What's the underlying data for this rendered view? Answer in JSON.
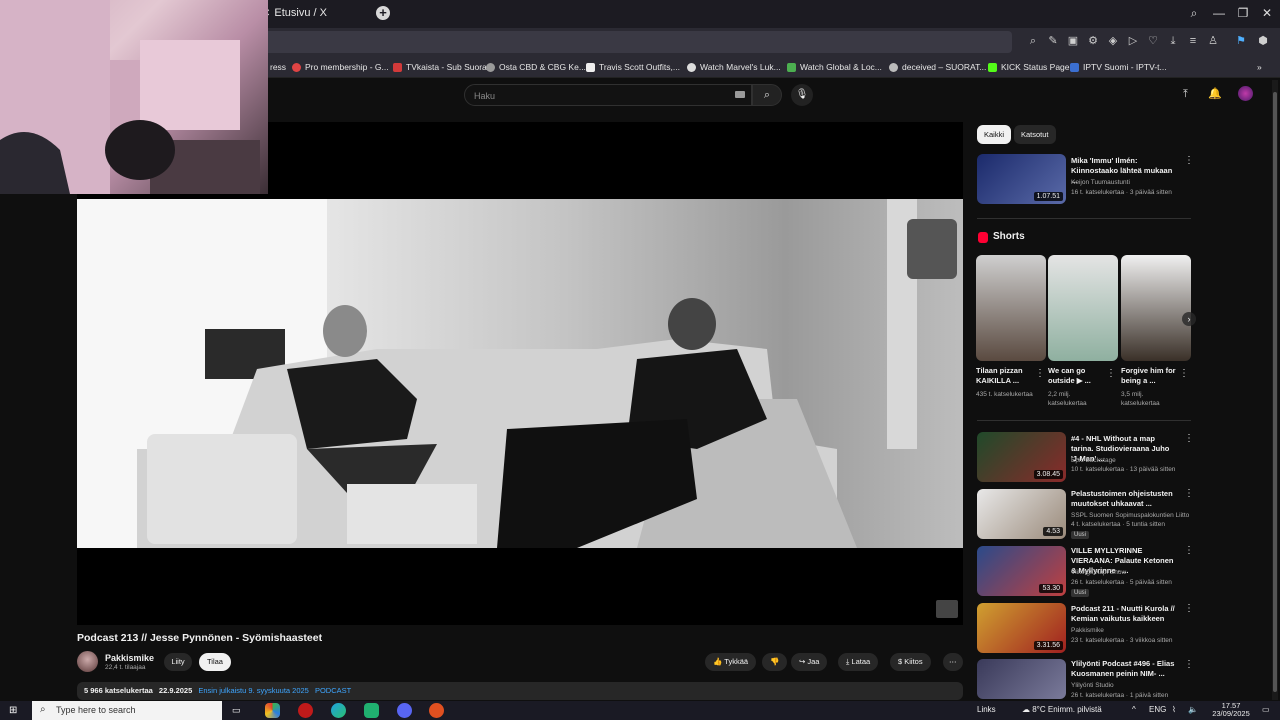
{
  "browser": {
    "active_tab": "Etusivu / X",
    "bookmarks": [
      {
        "label": "ress",
        "color": "#888888"
      },
      {
        "label": "Pro membership - G...",
        "color": "#e04444"
      },
      {
        "label": "TVkaista - Sub Suora",
        "color": "#d23a3a"
      },
      {
        "label": "Osta CBD & CBG Ke...",
        "color": "#9a9a9a"
      },
      {
        "label": "Travis Scott Outfits,...",
        "color": "#eeeeee"
      },
      {
        "label": "Watch Marvel's Luk...",
        "color": "#dddddd"
      },
      {
        "label": "Watch Global & Loc...",
        "color": "#4caf50"
      },
      {
        "label": "deceived – SUORAT...",
        "color": "#bbbbbb"
      },
      {
        "label": "KICK Status Page",
        "color": "#53fc18"
      },
      {
        "label": "IPTV Suomi - IPTV-t...",
        "color": "#3b6fd1"
      }
    ]
  },
  "youtube": {
    "search_placeholder": "Haku",
    "video": {
      "title": "Podcast 213 // Jesse Pynnönen - Syömishaasteet",
      "channel": "Pakkismike",
      "subscribers": "22,4 t. tilaajaa",
      "join_label": "Liity",
      "subscribe_label": "Tilaa",
      "like_label": "Tykkää",
      "share_label": "Jaa",
      "download_label": "Lataa",
      "thanks_label": "Kiitos",
      "views": "5 966 katselukertaa",
      "date": "22.9.2025",
      "premiere": "Ensin julkaistu 9. syyskuuta 2025",
      "tag": "PODCAST"
    },
    "chips": [
      "Kaikki",
      "Katsotut"
    ],
    "top_item": {
      "title": "Mika 'Immu' Ilmén: Kiinnostaako lähteä mukaan ...",
      "channel": "Keijon Tuumaustunti",
      "meta": "16 t. katselukertaa · 3 päivää sitten",
      "duration": "1.07.51"
    },
    "shorts_heading": "Shorts",
    "shorts": [
      {
        "title": "Tilaan pizzan KAIKILLA ...",
        "views": "435 t. katselukertaa"
      },
      {
        "title": "We can go outside ▶ ...",
        "views": "2,2 milj. katselukertaa"
      },
      {
        "title": "Forgive him for being a ...",
        "views": "3,5 milj. katselukertaa"
      }
    ],
    "related": [
      {
        "title": "#4 - NHL Without a map tarina. Studiovieraana Juho 'J-Man' ...",
        "channel": "Epic Backstage",
        "meta": "10 t. katselukertaa · 13 päivää sitten",
        "duration": "3.08.45",
        "badge": ""
      },
      {
        "title": "Pelastustoimen ohjeistusten muutokset uhkaavat ...",
        "channel": "SSPL Suomen Sopimuspalokuntien Liitto",
        "meta": "4 t. katselukertaa · 5 tuntia sitten",
        "duration": "4.53",
        "badge": "Uusi"
      },
      {
        "title": "VILLE MYLLYRINNE VIERAANA: Palaute Ketonen & Myllyrinne - ...",
        "channel": "Viikings Käpi Show",
        "meta": "26 t. katselukertaa · 5 päivää sitten",
        "duration": "53.30",
        "badge": "Uusi"
      },
      {
        "title": "Podcast 211 - Nuutti Kurola // Kemian vaikutus kaikkeen",
        "channel": "Pakkismike",
        "meta": "23 t. katselukertaa · 3 viikkoa sitten",
        "duration": "3.31.56",
        "badge": ""
      },
      {
        "title": "Ylilyönti Podcast #496 - Elias Kuosmanen peinin NIM- ...",
        "channel": "Ylilyönti Studio",
        "meta": "26 t. katselukertaa · 1 päivä sitten",
        "duration": "",
        "badge": ""
      }
    ]
  },
  "taskbar": {
    "search_placeholder": "Type here to search",
    "links": "Links",
    "weather": "8°C  Enimm. pilvistä",
    "lang": "ENG",
    "time": "17.57",
    "date": "23/09/2025"
  }
}
